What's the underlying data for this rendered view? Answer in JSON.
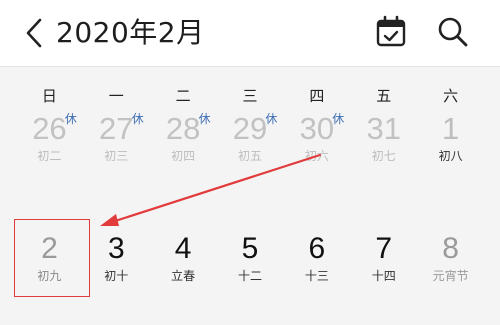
{
  "header": {
    "title": "2020年2月",
    "icons": {
      "back": "chevron-left-icon",
      "calendar": "calendar-check-icon",
      "search": "search-icon"
    }
  },
  "weekdays": [
    "日",
    "一",
    "二",
    "三",
    "四",
    "五",
    "六"
  ],
  "rows": [
    [
      {
        "day": "26",
        "lunar": "初二",
        "rest": "休"
      },
      {
        "day": "27",
        "lunar": "初三",
        "rest": "休"
      },
      {
        "day": "28",
        "lunar": "初四",
        "rest": "休"
      },
      {
        "day": "29",
        "lunar": "初五",
        "rest": "休"
      },
      {
        "day": "30",
        "lunar": "初六",
        "rest": "休"
      },
      {
        "day": "31",
        "lunar": "初七",
        "rest": ""
      },
      {
        "day": "1",
        "lunar": "初八",
        "rest": ""
      }
    ],
    [
      {
        "day": "2",
        "lunar": "初九",
        "rest": ""
      },
      {
        "day": "3",
        "lunar": "初十",
        "rest": ""
      },
      {
        "day": "4",
        "lunar": "立春",
        "rest": ""
      },
      {
        "day": "5",
        "lunar": "十二",
        "rest": ""
      },
      {
        "day": "6",
        "lunar": "十三",
        "rest": ""
      },
      {
        "day": "7",
        "lunar": "十四",
        "rest": ""
      },
      {
        "day": "8",
        "lunar": "元宵节",
        "rest": ""
      }
    ]
  ],
  "colors": {
    "accent_rest": "#3f6fb5",
    "annotation_red": "#e23b3b"
  }
}
